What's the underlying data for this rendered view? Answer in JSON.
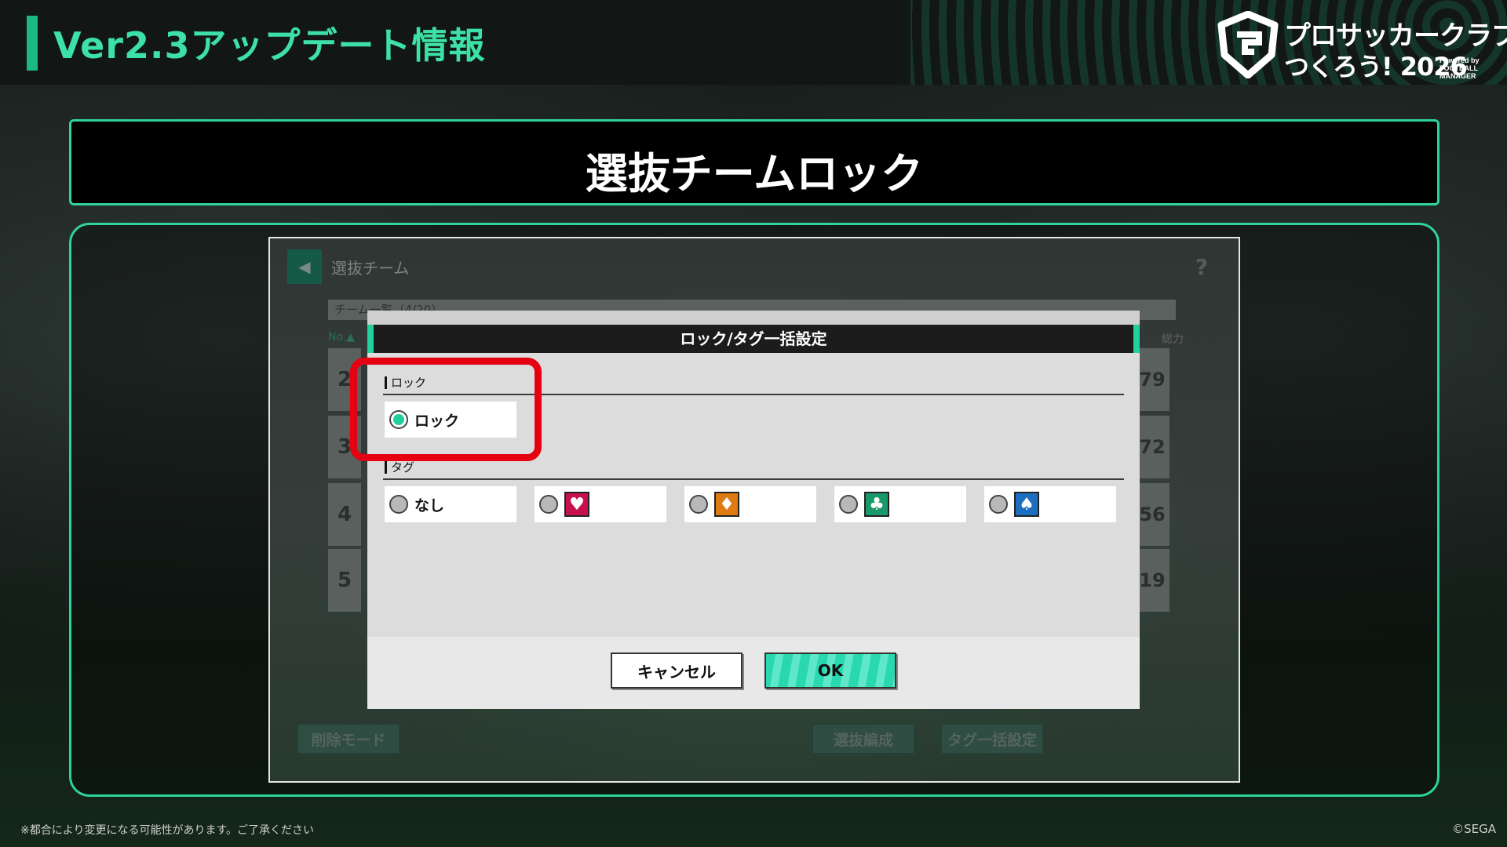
{
  "header": {
    "title": "Ver2.3アップデート情報",
    "logo_line1": "プロサッカークラブを",
    "logo_line2": "つくろう! 2026",
    "logo_fm": "Powered by FOOTBALL MANAGER"
  },
  "heading": "選抜チームロック",
  "game": {
    "screen_title": "選抜チーム",
    "list_title": "チーム一覧（4/20）",
    "col_no": "No.▲",
    "col_right": "総力",
    "rows": [
      {
        "no": "2",
        "val": "79"
      },
      {
        "no": "3",
        "val": "72"
      },
      {
        "no": "4",
        "val": "56"
      },
      {
        "no": "5",
        "val": "19"
      }
    ],
    "buttons": {
      "delete_mode": "削除モード",
      "select_edit": "選抜編成",
      "tag_bulk": "タグ一括設定"
    }
  },
  "modal": {
    "title": "ロック/タグ一括設定",
    "lock_section": "ロック",
    "lock_option": "ロック",
    "tag_section": "タグ",
    "tag_none": "なし",
    "tags": [
      {
        "icon": "heart-icon",
        "glyph": "♥",
        "color": "#c8104e"
      },
      {
        "icon": "diamond-icon",
        "glyph": "♦",
        "color": "#e07a12"
      },
      {
        "icon": "club-icon",
        "glyph": "♣",
        "color": "#1a9a6a"
      },
      {
        "icon": "spade-icon",
        "glyph": "♠",
        "color": "#1c6fc0"
      }
    ],
    "cancel": "キャンセル",
    "ok": "OK"
  },
  "footer": {
    "disclaimer": "※都合により変更になる可能性があります。ご了承ください",
    "copyright": "©SEGA"
  },
  "colors": {
    "accent": "#2fd39b",
    "highlight": "#e50012"
  }
}
